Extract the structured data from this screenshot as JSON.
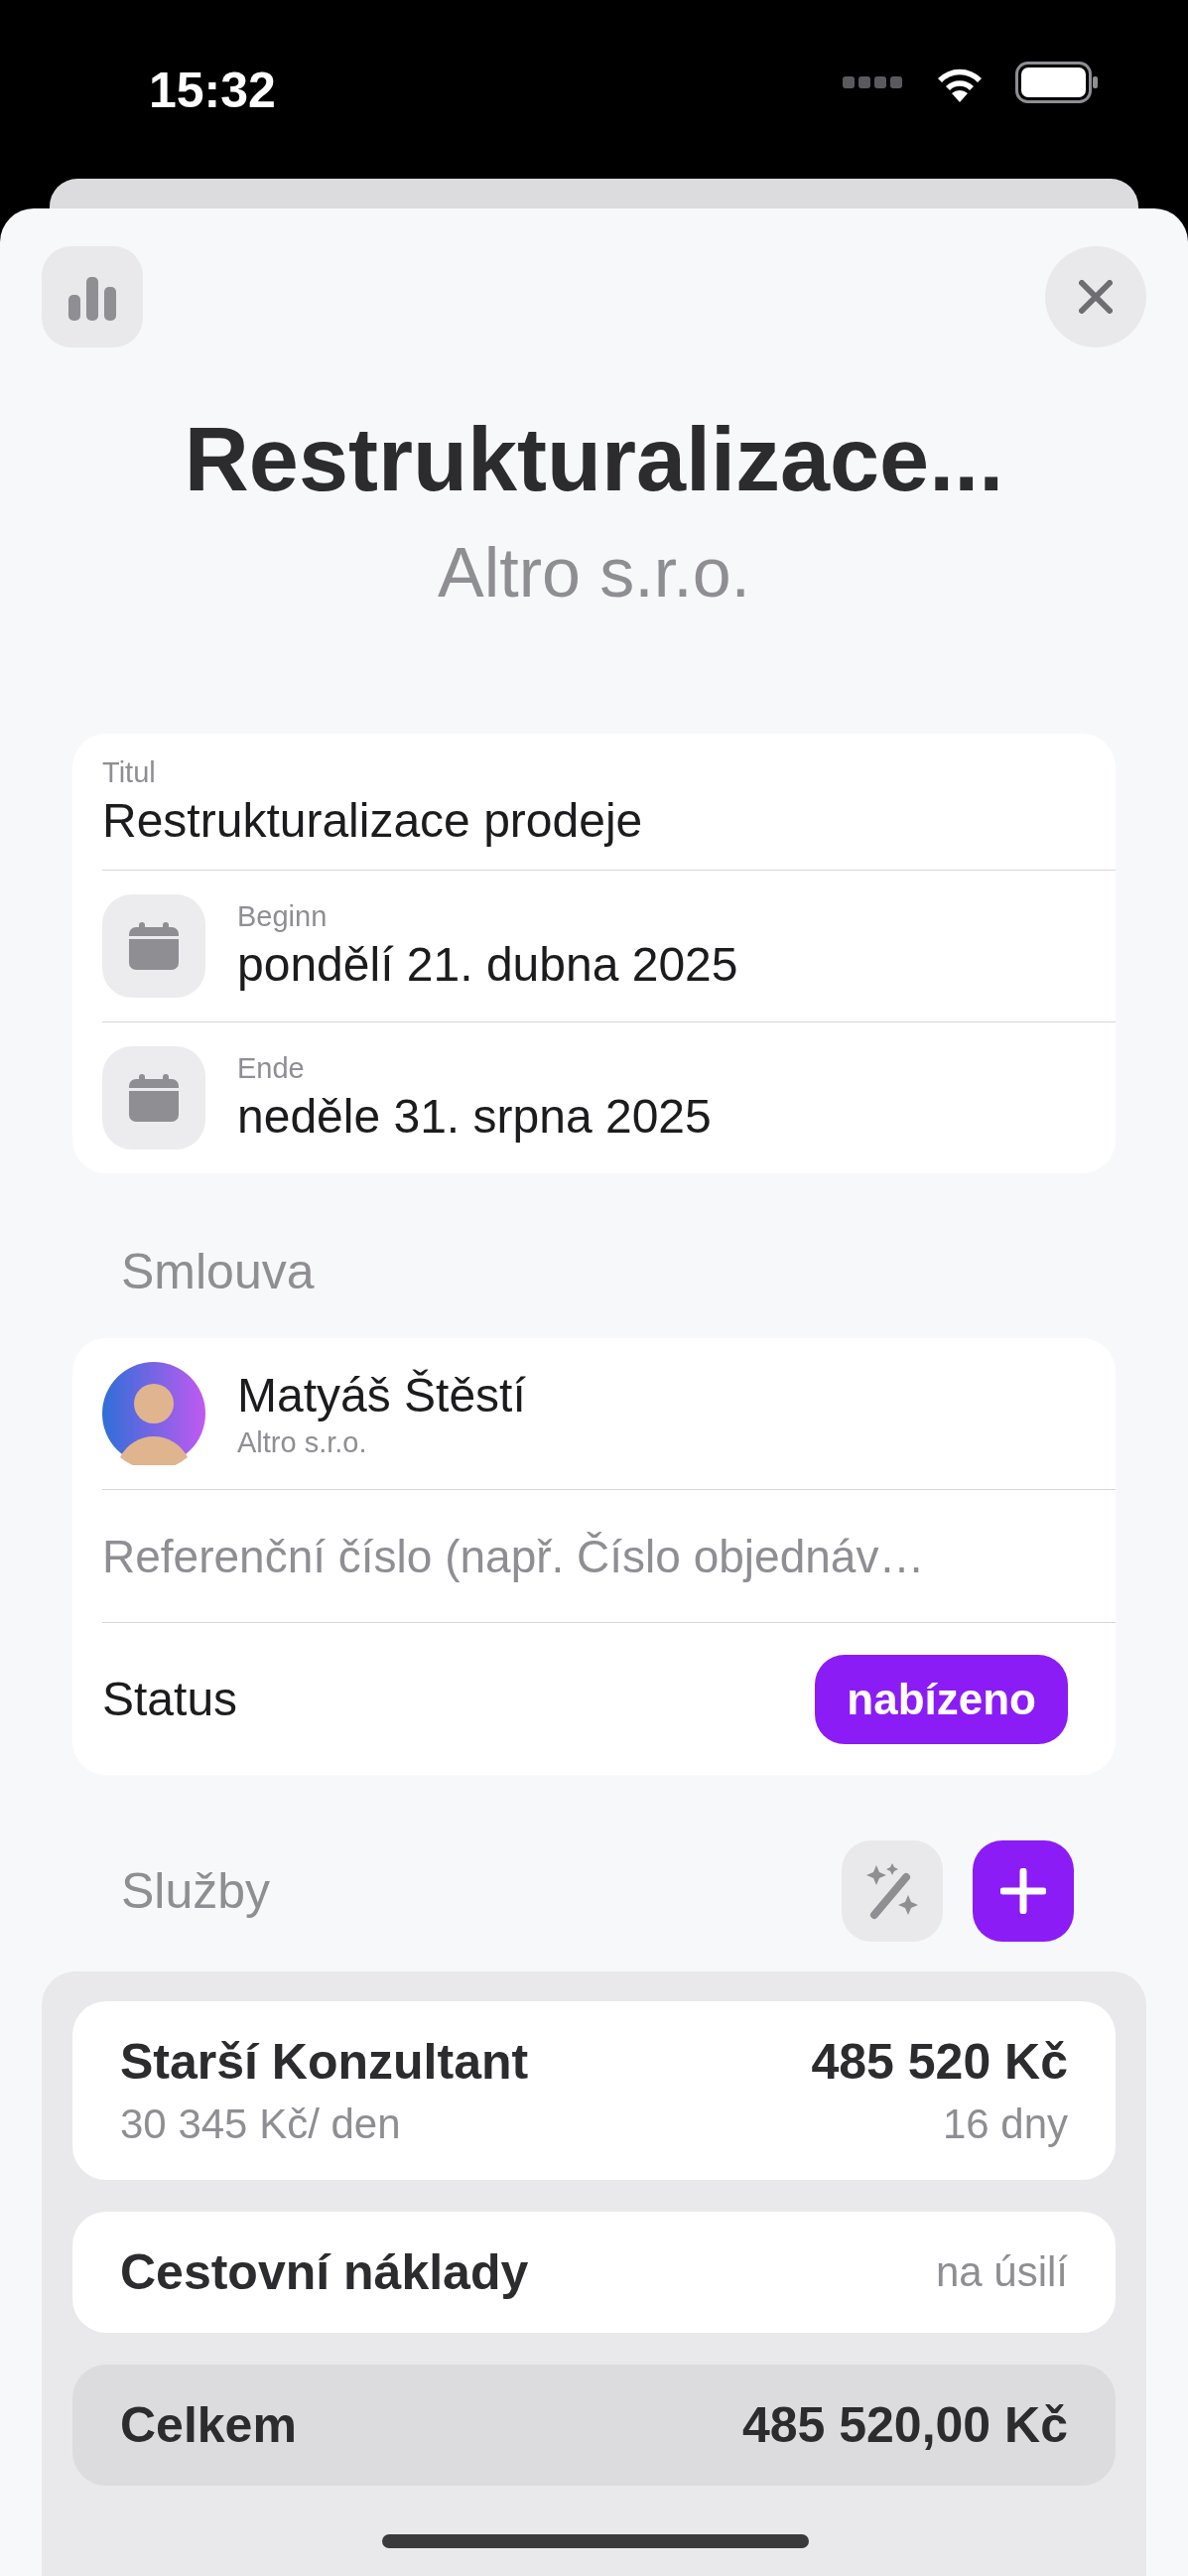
{
  "status_bar": {
    "time": "15:32"
  },
  "header": {
    "title": "Restrukturalizace...",
    "subtitle": "Altro s.r.o."
  },
  "details": [
    {
      "kind": "text",
      "label": "Titul",
      "value": "Restrukturalizace prodeje"
    },
    {
      "kind": "date",
      "label": "Beginn",
      "value": "pondělí 21. dubna 2025"
    },
    {
      "kind": "date",
      "label": "Ende",
      "value": "neděle 31. srpna 2025"
    }
  ],
  "contract": {
    "heading": "Smlouva",
    "contact": {
      "name": "Matyáš Štěstí",
      "company": "Altro s.r.o."
    },
    "reference": {
      "placeholder": "Referenční číslo (např. Číslo objednáv…"
    },
    "status": {
      "label": "Status",
      "value": "nabízeno"
    }
  },
  "services": {
    "heading": "Služby",
    "items": [
      {
        "kind": "rate",
        "name": "Starší Konzultant",
        "amount": "485 520 Kč",
        "rate": "30 345 Kč/ den",
        "duration": "16 dny"
      },
      {
        "kind": "note",
        "name": "Cestovní náklady",
        "note": "na úsilí"
      }
    ],
    "total": {
      "label": "Celkem",
      "amount": "485 520,00 Kč"
    }
  }
}
